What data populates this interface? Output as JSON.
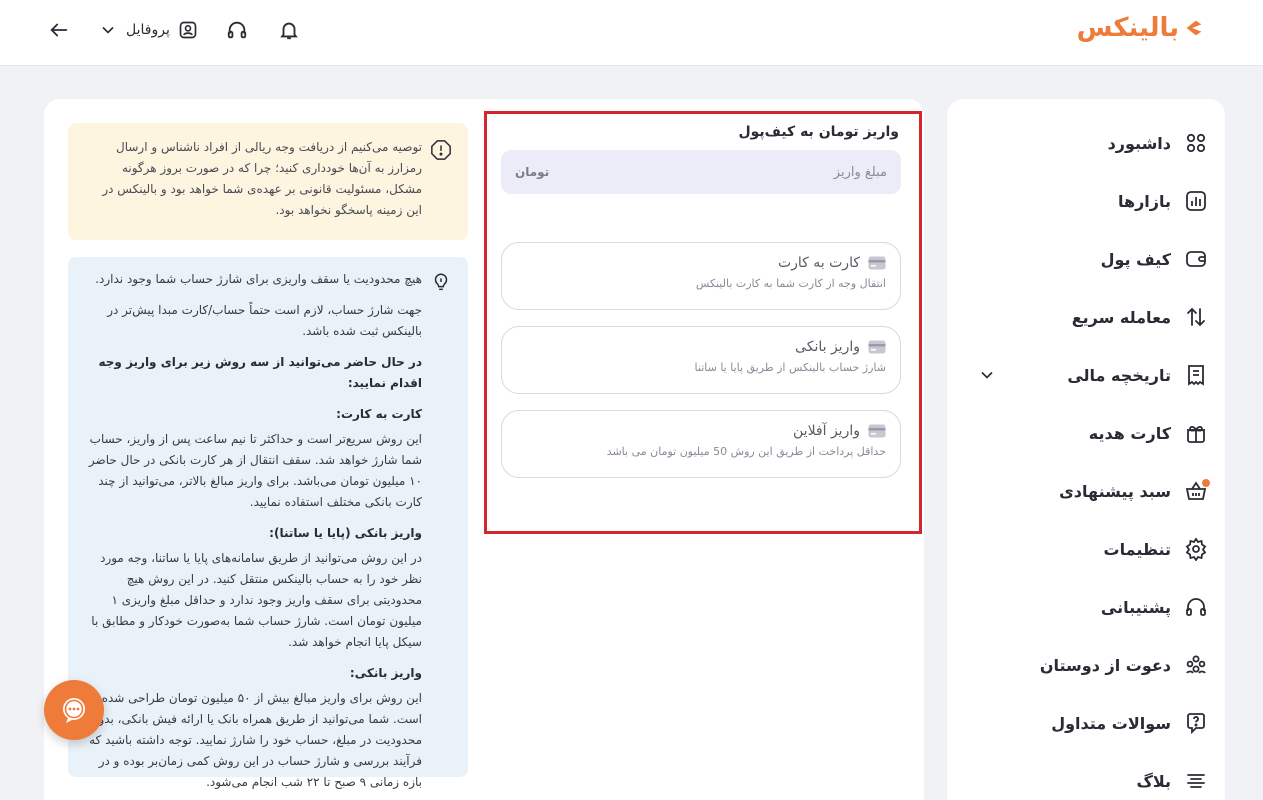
{
  "brand": {
    "logo_text": "بالینکس"
  },
  "header": {
    "profile_label": "پروفایل"
  },
  "sidebar": {
    "items": [
      {
        "label": "داشبورد",
        "icon": "grid-icon"
      },
      {
        "label": "بازارها",
        "icon": "markets-icon"
      },
      {
        "label": "کیف پول",
        "icon": "wallet-icon"
      },
      {
        "label": "معامله سریع",
        "icon": "swap-icon"
      },
      {
        "label": "تاریخچه مالی",
        "icon": "receipt-icon"
      },
      {
        "label": "کارت هدیه",
        "icon": "gift-icon"
      },
      {
        "label": "سبد پیشنهادی",
        "icon": "basket-icon"
      },
      {
        "label": "تنظیمات",
        "icon": "gear-icon"
      },
      {
        "label": "پشتیبانی",
        "icon": "headphones-icon"
      },
      {
        "label": "دعوت از دوستان",
        "icon": "users-icon"
      },
      {
        "label": "سوالات متداول",
        "icon": "question-icon"
      },
      {
        "label": "بلاگ",
        "icon": "blog-icon"
      }
    ]
  },
  "warning": {
    "text": "توصیه می‌کنیم از دریافت وجه ریالی از افراد ناشناس و ارسال رمزارز به آن‌ها خودداری کنید؛ چرا که در صورت بروز هرگونه مشکل، مسئولیت قانونی بر عهده‌ی شما خواهد بود و بالینکس در این زمینه پاسخگو نخواهد بود."
  },
  "info": {
    "p1": "هیچ محدودیت یا سقف واریزی برای شارژ حساب شما وجود ندارد.",
    "p2": "جهت شارژ حساب، لازم است حتماً حساب/کارت مبدا پیش‌تر در بالینکس ثبت شده باشد.",
    "p3": "در حال حاضر می‌توانید از سه روش زیر برای واریز وجه اقدام نمایید:",
    "h1": "کارت به کارت:",
    "t1": "این روش سریع‌تر است و حداکثر تا نیم ساعت پس از واریز، حساب شما شارژ خواهد شد. سقف انتقال از هر کارت بانکی در حال حاضر ۱۰ میلیون تومان می‌باشد. برای واریز مبالغ بالاتر، می‌توانید از چند کارت بانکی مختلف استفاده نمایید.",
    "h2": "واریز بانکی (پایا یا ساتنا):",
    "t2": "در این روش می‌توانید از طریق سامانه‌های پایا یا ساتنا، وجه مورد نظر خود را به حساب بالینکس منتقل کنید. در این روش هیچ محدودیتی برای سقف واریز وجود ندارد و حداقل مبلغ واریزی ۱ میلیون تومان است. شارژ حساب شما به‌صورت خودکار و مطابق با سیکل پایا انجام خواهد شد.",
    "h3": "واریز بانکی:",
    "t3": "این روش برای واریز مبالغ بیش از ۵۰ میلیون تومان طراحی شده است. شما می‌توانید از طریق همراه بانک یا ارائه فیش بانکی، بدون محدودیت در مبلغ، حساب خود را شارژ نمایید. توجه داشته باشید که فرآیند بررسی و شارژ حساب در این روش کمی زمان‌بر بوده و در بازه زمانی ۹ صبح تا ۲۲ شب انجام می‌شود."
  },
  "deposit": {
    "title": "واریز تومان به کیف‌پول",
    "amount_placeholder": "مبلغ واریز",
    "amount_unit": "تومان",
    "methods": [
      {
        "title": "کارت به کارت",
        "subtitle": "انتقال وجه از کارت شما به کارت بالینکس"
      },
      {
        "title": "واریز بانکی",
        "subtitle": "شارژ حساب بالینکس از طریق پایا یا ساتنا"
      },
      {
        "title": "واریز آفلاین",
        "subtitle": "حداقل پرداخت از طریق این روش 50 میلیون تومان می باشد"
      }
    ]
  }
}
